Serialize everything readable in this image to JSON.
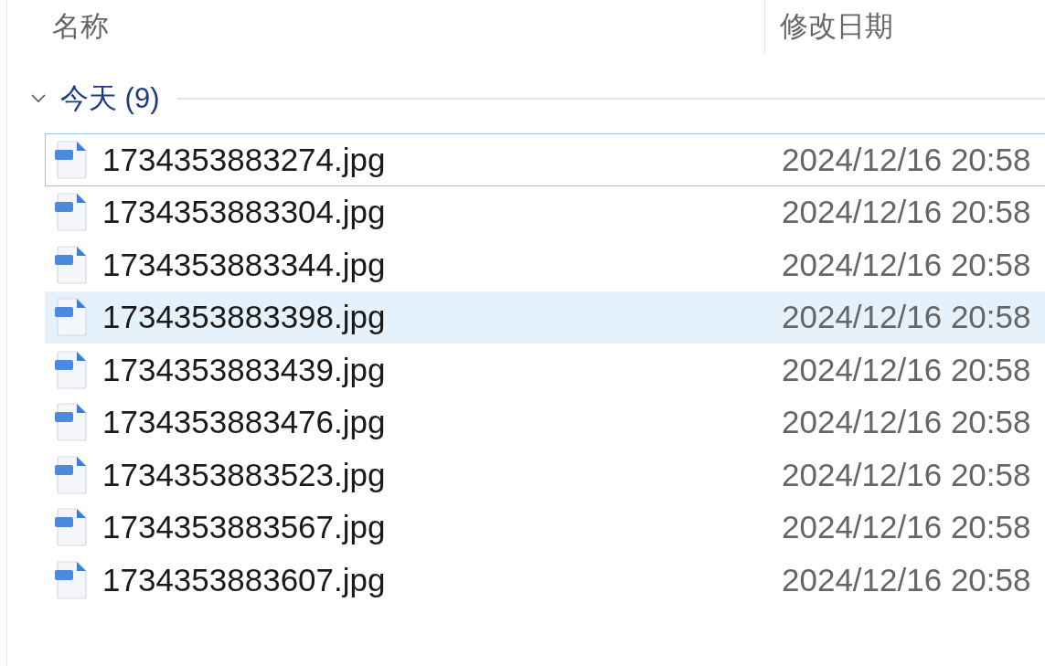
{
  "columns": [
    "名称",
    "修改日期"
  ],
  "group": {
    "label": "今天 (9)",
    "expanded": true
  },
  "files": [
    {
      "name": "1734353883274.jpg",
      "modified": "2024/12/16 20:58",
      "focused": true,
      "hovered": false
    },
    {
      "name": "1734353883304.jpg",
      "modified": "2024/12/16 20:58",
      "focused": false,
      "hovered": false
    },
    {
      "name": "1734353883344.jpg",
      "modified": "2024/12/16 20:58",
      "focused": false,
      "hovered": false
    },
    {
      "name": "1734353883398.jpg",
      "modified": "2024/12/16 20:58",
      "focused": false,
      "hovered": true
    },
    {
      "name": "1734353883439.jpg",
      "modified": "2024/12/16 20:58",
      "focused": false,
      "hovered": false
    },
    {
      "name": "1734353883476.jpg",
      "modified": "2024/12/16 20:58",
      "focused": false,
      "hovered": false
    },
    {
      "name": "1734353883523.jpg",
      "modified": "2024/12/16 20:58",
      "focused": false,
      "hovered": false
    },
    {
      "name": "1734353883567.jpg",
      "modified": "2024/12/16 20:58",
      "focused": false,
      "hovered": false
    },
    {
      "name": "1734353883607.jpg",
      "modified": "2024/12/16 20:58",
      "focused": false,
      "hovered": false
    }
  ]
}
